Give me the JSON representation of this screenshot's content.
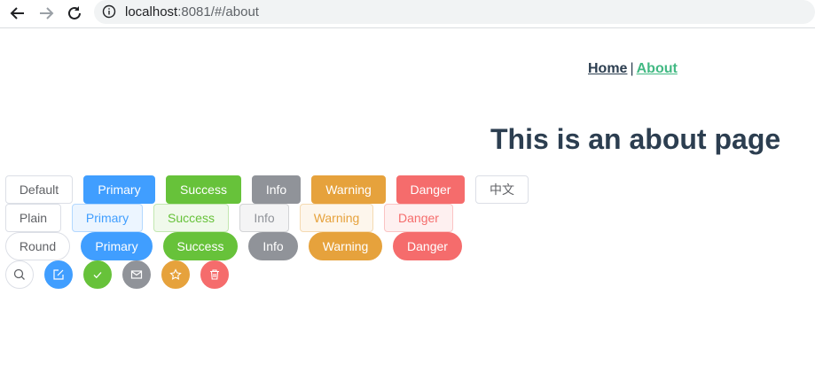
{
  "browser": {
    "url_host": "localhost",
    "url_rest": ":8081/#/about"
  },
  "nav": {
    "home": "Home",
    "separator": "|",
    "about": "About"
  },
  "page": {
    "title": "This is an about page"
  },
  "rows": {
    "default": [
      "Default",
      "Primary",
      "Success",
      "Info",
      "Warning",
      "Danger",
      "中文"
    ],
    "plain": [
      "Plain",
      "Primary",
      "Success",
      "Info",
      "Warning",
      "Danger"
    ],
    "round": [
      "Round",
      "Primary",
      "Success",
      "Info",
      "Warning",
      "Danger"
    ],
    "circle_icons": [
      "search-icon",
      "edit-icon",
      "check-icon",
      "message-icon",
      "star-icon",
      "delete-icon"
    ]
  },
  "colors": {
    "primary": "#409eff",
    "success": "#67c23a",
    "info": "#909399",
    "warning": "#e6a23c",
    "danger": "#f56c6c",
    "nav_active": "#42b983",
    "text": "#2c3e50"
  }
}
